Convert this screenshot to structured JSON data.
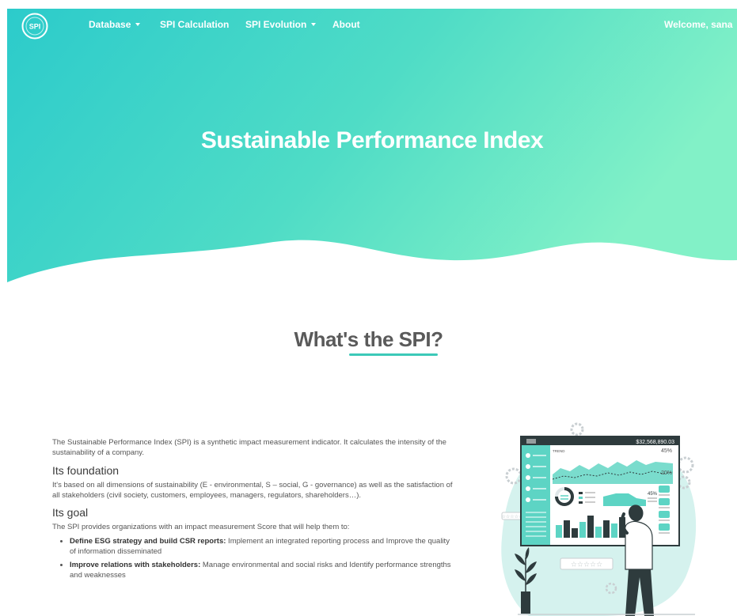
{
  "navbar": {
    "logo_text": "SPI",
    "items": [
      {
        "label": "Database",
        "dropdown": true
      },
      {
        "label": "SPI Calculation",
        "dropdown": false
      },
      {
        "label": "SPI Evolution",
        "dropdown": true
      },
      {
        "label": "About",
        "dropdown": false
      }
    ],
    "user_menu": {
      "label": "Welcome, sana",
      "dropdown": true
    }
  },
  "hero": {
    "title": "Sustainable Performance Index",
    "gradient": [
      "#2ecfc9",
      "#7ef0c6"
    ]
  },
  "section": {
    "title": "What's the SPI?",
    "accent_color": "#3cc9b8",
    "intro": "The Sustainable Performance Index (SPI) is a synthetic impact measurement indicator. It calculates the intensity of the sustainability of a company.",
    "foundation_heading": "Its foundation",
    "foundation_text": "It's based on all dimensions of sustainability (E - environmental, S – social, G - governance) as well as the satisfaction of all stakeholders (civil society, customers, employees, managers, regulators, shareholders…).",
    "goal_heading": "Its goal",
    "goal_text": "The SPI provides organizations with an impact measurement Score that will help them to:",
    "goals": [
      {
        "bold": "Define ESG strategy and build CSR reports:",
        "text": " Implement an integrated reporting process and Improve the quality of information disseminated"
      },
      {
        "bold": "Improve relations with stakeholders:",
        "text": " Manage environmental and social risks and Identify performance strengths and weaknesses"
      }
    ]
  },
  "illustration": {
    "amount": "$32,568,890.03",
    "trend_label": "TREND",
    "pct_top": "45%",
    "pct_mid": "20%",
    "pct_gauge": "45%",
    "stars": "☆☆☆☆☆"
  }
}
